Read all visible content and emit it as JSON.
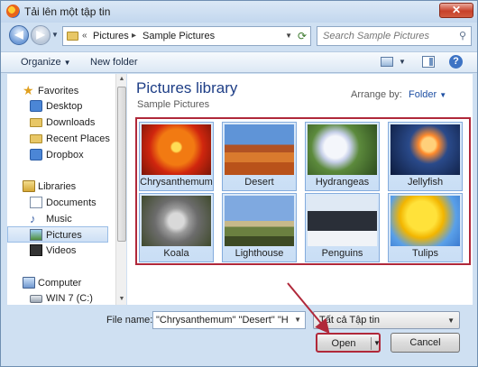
{
  "window": {
    "title": "Tải lên một tập tin",
    "close_label": "✕"
  },
  "address": {
    "crumb_root": "«",
    "crumbs": [
      "Pictures",
      "Sample Pictures"
    ],
    "search_placeholder": "Search Sample Pictures"
  },
  "toolbar": {
    "organize_label": "Organize",
    "new_folder_label": "New folder",
    "help_label": "?"
  },
  "sidebar": {
    "items": [
      {
        "label": "Favorites"
      },
      {
        "label": "Desktop"
      },
      {
        "label": "Downloads"
      },
      {
        "label": "Recent Places"
      },
      {
        "label": "Dropbox"
      },
      {
        "label": "Libraries"
      },
      {
        "label": "Documents"
      },
      {
        "label": "Music"
      },
      {
        "label": "Pictures"
      },
      {
        "label": "Videos"
      },
      {
        "label": "Computer"
      },
      {
        "label": "WIN 7 (C:)"
      }
    ]
  },
  "content": {
    "library_title": "Pictures library",
    "library_subtitle": "Sample Pictures",
    "arrange_label": "Arrange by:",
    "arrange_value": "Folder",
    "files": [
      {
        "name": "Chrysanthemum"
      },
      {
        "name": "Desert"
      },
      {
        "name": "Hydrangeas"
      },
      {
        "name": "Jellyfish"
      },
      {
        "name": "Koala"
      },
      {
        "name": "Lighthouse"
      },
      {
        "name": "Penguins"
      },
      {
        "name": "Tulips"
      }
    ]
  },
  "footer": {
    "filename_label": "File name:",
    "filename_value": "\"Chrysanthemum\" \"Desert\" \"Hydr",
    "filter_value": "Tất cả Tập tin",
    "open_label": "Open",
    "cancel_label": "Cancel"
  },
  "colors": {
    "highlight_frame": "#b0283a",
    "title_blue": "#1e3e86",
    "window_chrome": "#cfe0f2"
  }
}
